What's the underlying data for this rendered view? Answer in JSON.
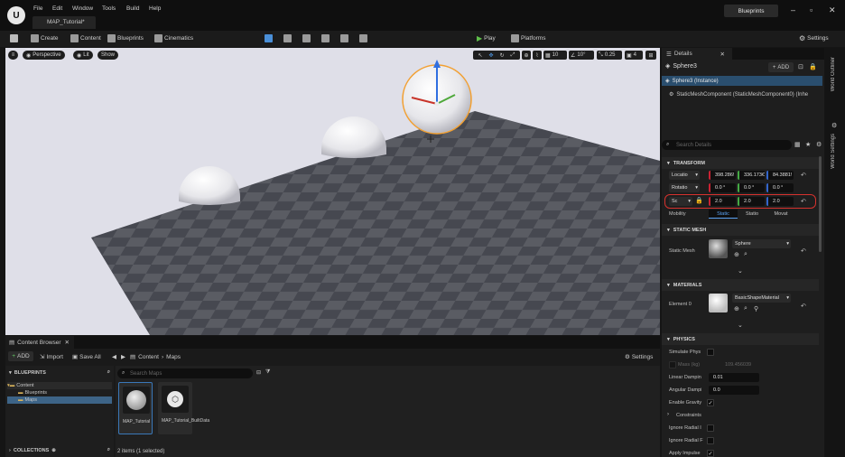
{
  "titlebar": {
    "logo": "U",
    "menu": [
      "File",
      "Edit",
      "Window",
      "Tools",
      "Build",
      "Help"
    ],
    "tab": "MAP_Tutorial*",
    "badge": "Blueprints"
  },
  "toolbar": {
    "create": "Create",
    "content": "Content",
    "blueprints": "Blueprints",
    "cinematics": "Cinematics",
    "play": "Play",
    "platforms": "Platforms",
    "settings": "Settings"
  },
  "viewport": {
    "perspective": "Perspective",
    "lit": "Lit",
    "show": "Show",
    "grid_snap": "10",
    "angle_snap": "10°",
    "scale_snap": "0.25",
    "cam_speed": "4"
  },
  "details": {
    "tab": "Details",
    "actor": "Sphere3",
    "add": "ADD",
    "instance": "Sphere3 (Instance)",
    "component": "StaticMeshComponent (StaticMeshComponent0) (Inhe",
    "search_placeholder": "Search Details",
    "transform_title": "TRANSFORM",
    "location_label": "Locatio",
    "location": [
      "398.286!",
      "336.173€",
      "84.3881!"
    ],
    "rotation_label": "Rotatio",
    "rotation": [
      "0.0 °",
      "0.0 °",
      "0.0 °"
    ],
    "scale_label": "Sc",
    "scale": [
      "2.0",
      "2.0",
      "2.0"
    ],
    "mobility_label": "Mobility",
    "mobility": [
      "Static",
      "Statio",
      "Movat"
    ],
    "static_mesh_title": "STATIC MESH",
    "static_mesh_label": "Static Mesh",
    "static_mesh_value": "Sphere",
    "materials_title": "MATERIALS",
    "element_label": "Element 0",
    "material_value": "BasicShapeMaterial",
    "physics_title": "PHYSICS",
    "physics": {
      "simulate": "Simulate Phys",
      "mass": "Mass (kg)",
      "mass_value": "109.456039",
      "linear": "Linear Dampin",
      "linear_value": "0.01",
      "angular": "Angular Dampi",
      "angular_value": "0.0",
      "gravity": "Enable Gravity",
      "constraints": "Constraints",
      "ignore1": "Ignore Radial I",
      "ignore2": "Ignore Radial F",
      "apply": "Apply Impulse"
    }
  },
  "side_strip": {
    "outliner": "World Outliner",
    "world_settings": "World Settings"
  },
  "content_browser": {
    "tab": "Content Browser",
    "add": "ADD",
    "import": "Import",
    "save_all": "Save All",
    "breadcrumb": [
      "Content",
      "Maps"
    ],
    "settings": "Settings",
    "favorites": "BLUEPRINTS",
    "tree": [
      "Content",
      "Blueprints",
      "Maps"
    ],
    "collections": "COLLECTIONS",
    "search_placeholder": "Search Maps",
    "assets": [
      "MAP_Tutorial",
      "MAP_Tutorial_BuiltData"
    ],
    "status": "2 items (1 selected)"
  }
}
